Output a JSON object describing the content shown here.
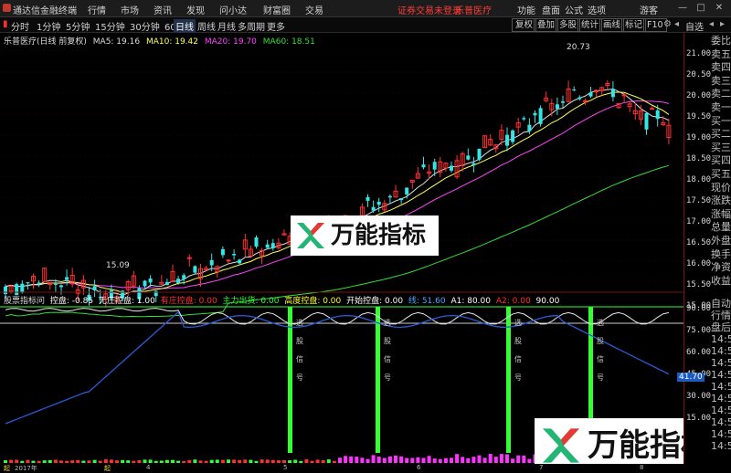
{
  "titlebar": {
    "app_title": "通达信金融终端",
    "menus": [
      "行情",
      "市场",
      "资讯",
      "发现",
      "问小达",
      "财富圈",
      "交易"
    ],
    "notice": "证券交易未登录",
    "stock_tab": "乐普医疗",
    "right_menus": [
      "功能",
      "盘面",
      "公式",
      "选项"
    ],
    "guest": "游客"
  },
  "periodbar": {
    "periods": [
      "分时",
      "1分钟",
      "5分钟",
      "15分钟",
      "30分钟",
      "60分钟",
      "日线",
      "周线",
      "月线",
      "多周期",
      "更多"
    ],
    "active": "日线",
    "tools": [
      "复权",
      "叠加",
      "多股",
      "统计",
      "画线",
      "标记",
      "F10"
    ],
    "right_nav": "自选"
  },
  "main_legend": {
    "name": "乐普医疗(日线 前复权)",
    "ma5": "MA5: 19.16",
    "ma10": "MA10: 19.42",
    "ma20": "MA20: 19.70",
    "ma60": "MA60: 18.51",
    "high_label": "20.73",
    "low_label": "15.09"
  },
  "sub_legend": {
    "name": "股票指标问",
    "items": [
      {
        "label": "控盘: -0.85",
        "color": "#ffffff"
      },
      {
        "label": "无庄控盘: 1.00",
        "color": "#ffffff"
      },
      {
        "label": "有庄控盘: 0.00",
        "color": "#ff3030"
      },
      {
        "label": "主力出货: 0.00",
        "color": "#33ff33"
      },
      {
        "label": "高度控盘: 0.00",
        "color": "#ffff33"
      },
      {
        "label": "开始控盘: 0.00",
        "color": "#ffffff"
      },
      {
        "label": "线: 51.60",
        "color": "#4aa3ff"
      },
      {
        "label": "A1: 80.00",
        "color": "#ffffff"
      },
      {
        "label": "A2: 0.00",
        "color": "#ff3030"
      },
      {
        "label": "90.00",
        "color": "#ffffff"
      }
    ]
  },
  "price_axis": [
    "21.00",
    "20.50",
    "20.00",
    "19.50",
    "19.00",
    "18.50",
    "18.00",
    "17.50",
    "17.00",
    "16.50",
    "16.00",
    "15.50",
    "15.00"
  ],
  "sub_axis": [
    "90.00",
    "75.00",
    "60.00",
    "45.00",
    "30.00",
    "15.00"
  ],
  "sub_marker": "41.70",
  "right_col": {
    "top": [
      "委比",
      "卖五",
      "卖四",
      "卖三",
      "卖二",
      "卖一",
      "买一",
      "买二",
      "买三",
      "买四",
      "买五",
      "现价",
      "涨跌",
      "涨幅",
      "总量",
      "外盘",
      "换手",
      "净资",
      "收益"
    ],
    "bottom": [
      "自动",
      "行情",
      "盘后",
      "14:5",
      "14:5",
      "14:5",
      "14:5",
      "14:5",
      "14:5",
      "14:5",
      "14:5",
      "14:5",
      "14:5"
    ]
  },
  "signal_text": [
    "选",
    "股",
    "信",
    "号"
  ],
  "dates": [
    "起",
    "起",
    "2017年",
    "4",
    "5",
    "6",
    "7",
    "8"
  ],
  "watermark": {
    "text": "万能指标"
  }
}
